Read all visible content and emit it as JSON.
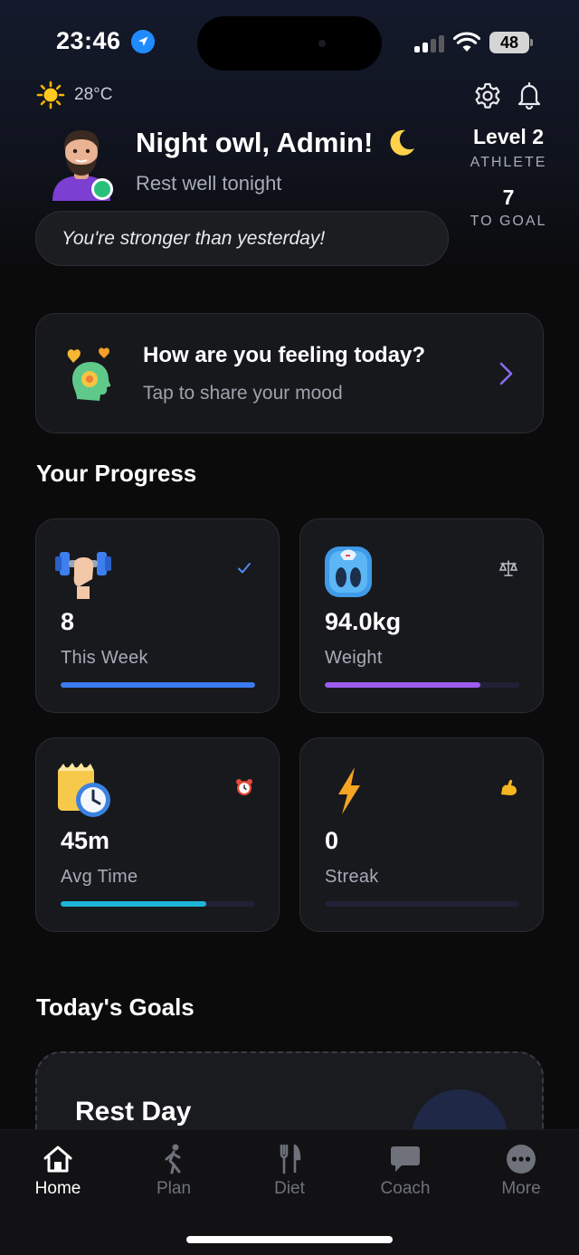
{
  "status_bar": {
    "time": "23:46",
    "battery": "48"
  },
  "header": {
    "temperature": "28°C",
    "greeting": "Night owl, Admin!",
    "subtitle": "Rest well tonight",
    "level_title": "Level 2",
    "level_sub": "ATHLETE",
    "goal_count": "7",
    "goal_sub": "TO GOAL",
    "motto": "You're stronger than yesterday!"
  },
  "mood": {
    "title": "How are you feeling today?",
    "subtitle": "Tap to share your mood"
  },
  "progress": {
    "title": "Your Progress",
    "cards": [
      {
        "value": "8",
        "label": "This Week",
        "icon": "dumbbell-icon",
        "badge": "check-icon",
        "fill": 1.0,
        "color": "#3b7bf0"
      },
      {
        "value": "94.0kg",
        "label": "Weight",
        "icon": "scale-icon",
        "badge": "balance-icon",
        "fill": 0.8,
        "color": "#9b5cf0"
      },
      {
        "value": "45m",
        "label": "Avg Time",
        "icon": "stopwatch-icon",
        "badge": "alarm-clock-icon",
        "fill": 0.75,
        "color": "#1fb5d8"
      },
      {
        "value": "0",
        "label": "Streak",
        "icon": "lightning-icon",
        "badge": "flexed-biceps-icon",
        "fill": 0.0,
        "color": "#f5a524"
      }
    ]
  },
  "goals": {
    "title": "Today's Goals",
    "card_title": "Rest Day"
  },
  "tabs": [
    {
      "label": "Home",
      "icon": "home-icon",
      "active": true
    },
    {
      "label": "Plan",
      "icon": "walking-icon",
      "active": false
    },
    {
      "label": "Diet",
      "icon": "fork-knife-icon",
      "active": false
    },
    {
      "label": "Coach",
      "icon": "chat-bubble-icon",
      "active": false
    },
    {
      "label": "More",
      "icon": "more-icon",
      "active": false
    }
  ]
}
